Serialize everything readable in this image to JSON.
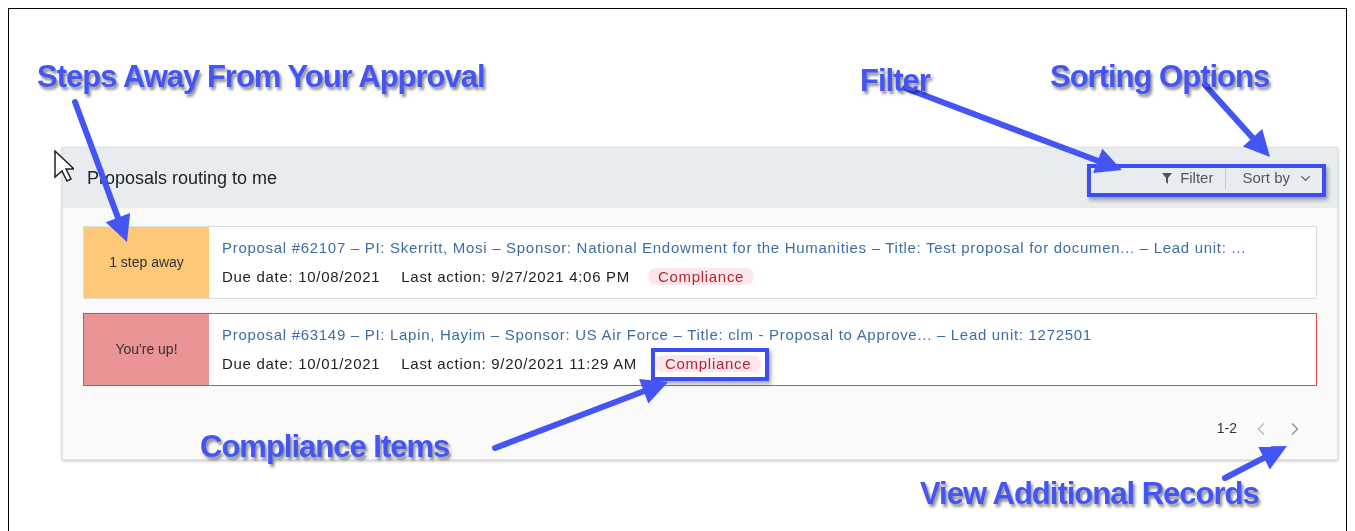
{
  "panel": {
    "title": "Proposals routing to me",
    "filter_button": "Filter",
    "sort_button": "Sort by"
  },
  "proposals": [
    {
      "kind": "waiting",
      "status": "1 step away",
      "title": "Proposal #62107 – PI: Skerritt, Mosi – Sponsor: National Endowment for the Humanities – Title: Test proposal for documen... – Lead unit: ...",
      "due": "Due date: 10/08/2021",
      "last_action": "Last action: 9/27/2021 4:06 PM",
      "tag": "Compliance"
    },
    {
      "kind": "your-turn",
      "status": "You're up!",
      "title": "Proposal #63149 – PI: Lapin, Hayim – Sponsor: US Air Force – Title: clm - Proposal to Approve... – Lead unit: 1272501",
      "due": "Due date: 10/01/2021",
      "last_action": "Last action: 9/20/2021 11:29 AM",
      "tag": "Compliance"
    }
  ],
  "pagination": {
    "range": "1-2"
  },
  "annotations": [
    {
      "text": "Steps Away From Your Approval"
    },
    {
      "text": "Filter"
    },
    {
      "text": "Sorting Options"
    },
    {
      "text": "Compliance Items"
    },
    {
      "text": "View Additional Records"
    }
  ]
}
